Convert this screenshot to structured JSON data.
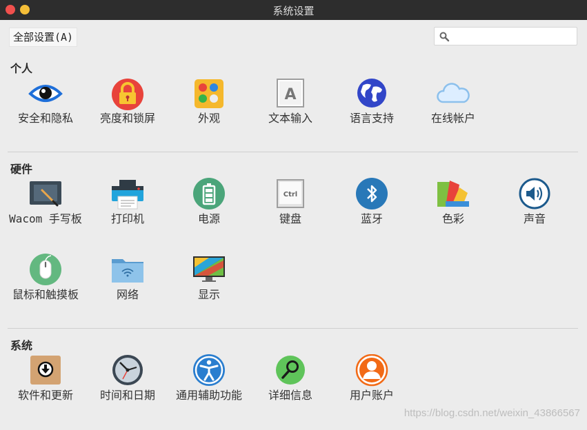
{
  "window": {
    "title": "系统设置"
  },
  "toolbar": {
    "all_settings": "全部设置(A)",
    "search_placeholder": ""
  },
  "sections": {
    "personal": "个人",
    "hardware": "硬件",
    "system": "系统"
  },
  "personal": [
    {
      "label": "安全和隐私",
      "icon": "eye-icon"
    },
    {
      "label": "亮度和锁屏",
      "icon": "lock-icon"
    },
    {
      "label": "外观",
      "icon": "appearance-icon"
    },
    {
      "label": "文本输入",
      "icon": "text-entry-icon"
    },
    {
      "label": "语言支持",
      "icon": "globe-icon"
    },
    {
      "label": "在线帐户",
      "icon": "cloud-icon"
    }
  ],
  "hardware": [
    {
      "label": "Wacom 手写板",
      "icon": "tablet-icon"
    },
    {
      "label": "打印机",
      "icon": "printer-icon"
    },
    {
      "label": "电源",
      "icon": "battery-icon"
    },
    {
      "label": "键盘",
      "icon": "keyboard-icon",
      "key_text": "Ctrl"
    },
    {
      "label": "蓝牙",
      "icon": "bluetooth-icon"
    },
    {
      "label": "色彩",
      "icon": "color-icon"
    },
    {
      "label": "声音",
      "icon": "sound-icon"
    },
    {
      "label": "鼠标和触摸板",
      "icon": "mouse-icon"
    },
    {
      "label": "网络",
      "icon": "network-folder-icon"
    },
    {
      "label": "显示",
      "icon": "display-icon"
    }
  ],
  "system": [
    {
      "label": "软件和更新",
      "icon": "software-update-icon"
    },
    {
      "label": "时间和日期",
      "icon": "clock-icon"
    },
    {
      "label": "通用辅助功能",
      "icon": "accessibility-icon"
    },
    {
      "label": "详细信息",
      "icon": "magnifier-info-icon"
    },
    {
      "label": "用户账户",
      "icon": "user-icon"
    }
  ],
  "watermark": "https://blog.csdn.net/weixin_43866567",
  "colors": {
    "titlebar": "#2d2d2d",
    "close": "#f0504d",
    "minimize": "#f4be38",
    "background": "#ececec"
  }
}
